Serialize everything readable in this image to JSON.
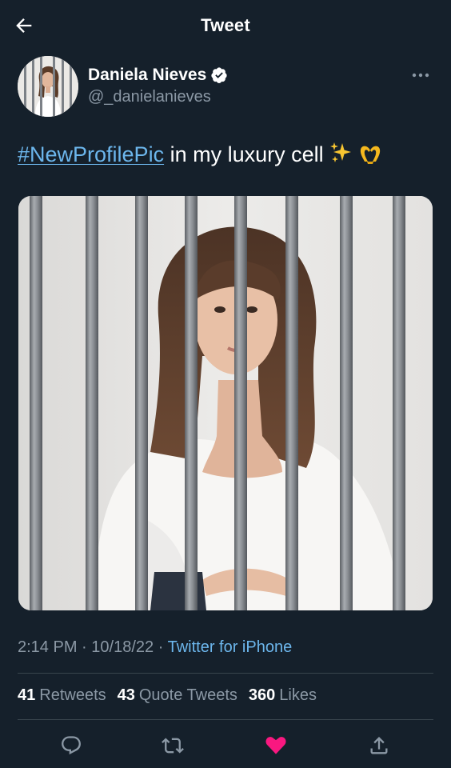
{
  "header": {
    "title": "Tweet",
    "back_icon": "arrow-left-icon"
  },
  "author": {
    "display_name": "Daniela Nieves",
    "handle": "@_danielanieves",
    "verified": true,
    "verified_icon": "verified-badge-icon",
    "more_icon": "more-horizontal-icon"
  },
  "tweet": {
    "hashtag": "#NewProfilePic",
    "text": " in my luxury cell",
    "emojis": [
      "sparkles-icon",
      "heart-hands-icon"
    ],
    "media": {
      "type": "photo",
      "description_icon": "photo-behind-bars"
    }
  },
  "meta": {
    "time": "2:14 PM",
    "separator": "·",
    "date": "10/18/22",
    "separator2": "·",
    "source": "Twitter for iPhone"
  },
  "stats": {
    "retweets_count": "41",
    "retweets_label": "Retweets",
    "quote_count": "43",
    "quote_label": "Quote Tweets",
    "likes_count": "360",
    "likes_label": "Likes"
  },
  "actions": [
    {
      "name": "reply-icon"
    },
    {
      "name": "retweet-icon"
    },
    {
      "name": "like-icon",
      "active": true
    },
    {
      "name": "share-icon"
    }
  ],
  "colors": {
    "background": "#15202b",
    "link": "#6cb6ec",
    "secondary_text": "#8b98a5",
    "verified": "#ffffff",
    "like_active": "#f91880",
    "divider": "#38444d"
  }
}
